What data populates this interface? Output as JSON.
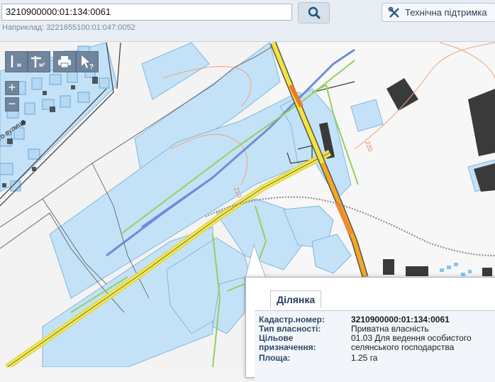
{
  "search": {
    "value": "3210900000:01:134:0061",
    "example_text": "Наприклад: 3221655100:01:047:0052"
  },
  "support": {
    "label": "Технічна підтримка"
  },
  "tools": {
    "measure_length_label": "м",
    "measure_area_label": "м²"
  },
  "map": {
    "street_label": "го вулиця",
    "contour_labels": [
      "210",
      "210",
      "220"
    ]
  },
  "popup": {
    "tab_label": "Ділянка",
    "rows": [
      {
        "label": "Кадастр.номер:",
        "value": "3210900000:01:134:0061"
      },
      {
        "label": "Тип власності:",
        "value": "Приватна власність"
      },
      {
        "label": "Цільове призначення:",
        "value": "01.03 Для ведення особистого селянського господарства"
      },
      {
        "label": "Площа:",
        "value": "1.25 га"
      }
    ]
  },
  "colors": {
    "parcel_fill": "#c4e2f7",
    "parcel_stroke": "#7fb7de",
    "road_yellow": "#f0e43a",
    "road_orange": "#f28a1a",
    "boundary_green": "#93d05a",
    "building_dark": "#3a3a3a",
    "toolbar_button": "#6f869c"
  }
}
